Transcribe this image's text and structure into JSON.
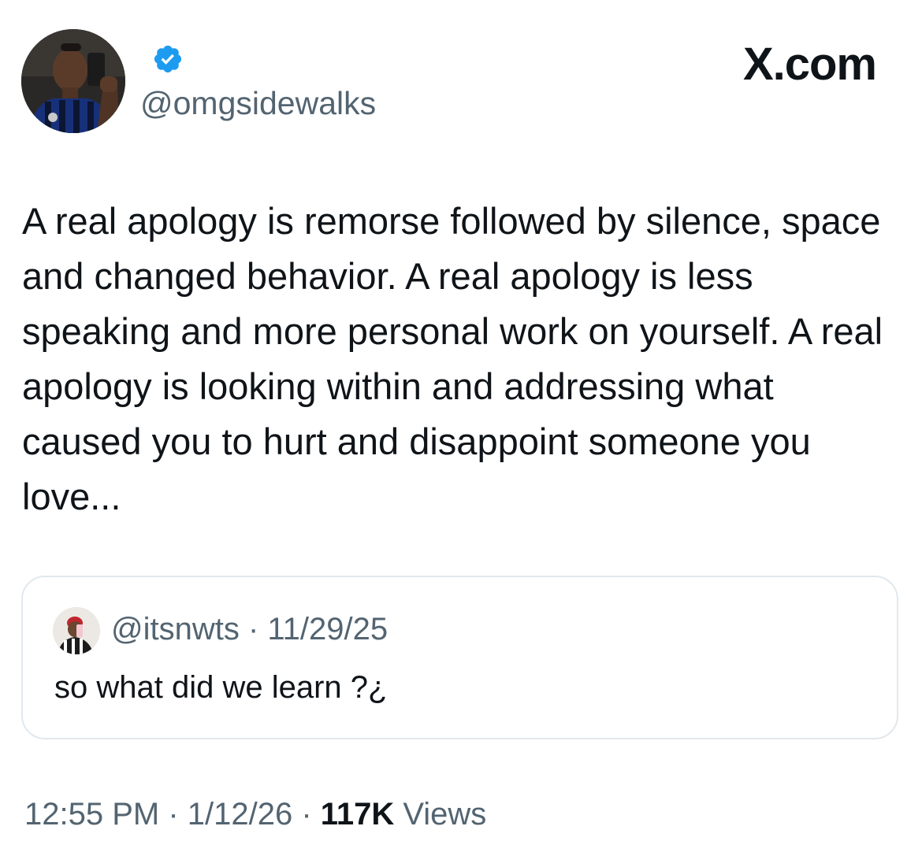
{
  "author": {
    "handle": "@omgsidewalks",
    "verified": true,
    "verified_color": "#1d9bf0"
  },
  "brand": "X.com",
  "tweet": {
    "text": "A real apology is remorse followed by silence, space and changed behavior. A real apology is less speaking and more personal work on yourself. A real apology is looking within and addressing what caused you to hurt and disappoint someone you love..."
  },
  "quoted": {
    "handle": "@itsnwts",
    "separator": " · ",
    "date": "11/29/25",
    "text": "so what did we learn ?¿"
  },
  "footer": {
    "time": "12:55 PM",
    "sep1": " · ",
    "date": "1/12/26",
    "sep2": " · ",
    "views_count": "117K",
    "views_label": " Views"
  },
  "icons": {
    "verified": "verified-badge-icon",
    "avatar": "user-avatar",
    "quoted_avatar": "quoted-user-avatar"
  }
}
